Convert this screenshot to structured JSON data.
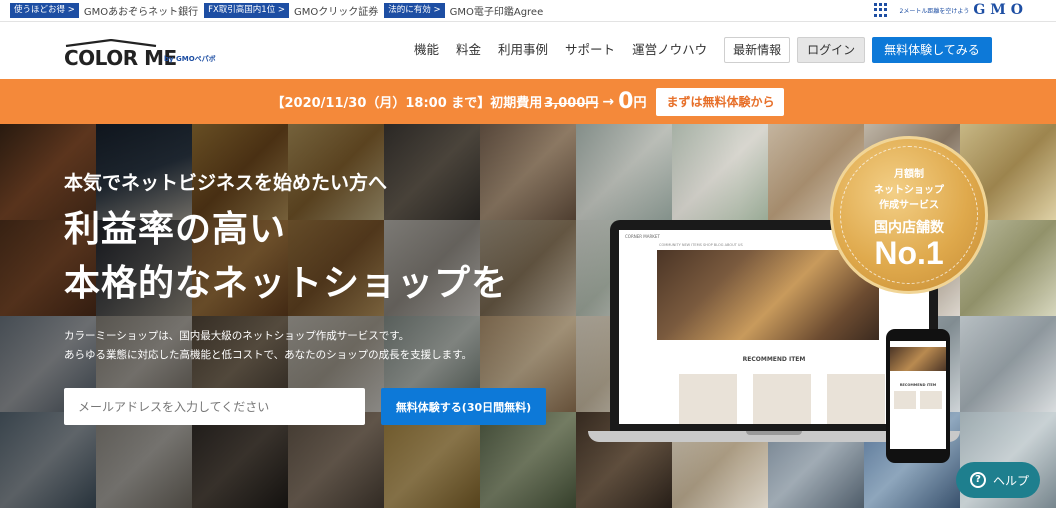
{
  "gmo_bar": {
    "links": [
      {
        "badge": "使うほどお得 >",
        "text": "GMOあおぞらネット銀行"
      },
      {
        "badge": "FX取引高国内1位 >",
        "text": "GMOクリック証券"
      },
      {
        "badge": "法的に有効 >",
        "text": "GMO電子印鑑Agree"
      }
    ],
    "tagline": "2メートル距離を空けよう",
    "logo": "GMO"
  },
  "header": {
    "logo_text": "COLOR ME",
    "logo_by": "by GMOペパボ",
    "nav": [
      "機能",
      "料金",
      "利用事例",
      "サポート",
      "運営ノウハウ"
    ],
    "news_label": "最新情報",
    "login_label": "ログイン",
    "trial_label": "無料体験してみる"
  },
  "campaign": {
    "text": "【2020/11/30（月）18:00 まで】初期費用",
    "old_price": "3,000円",
    "arrow": "→",
    "new_price": "0",
    "yen": "円",
    "button_label": "まずは無料体験から",
    "colors": {
      "background": "#f4893a"
    }
  },
  "hero": {
    "lead": "本気でネットビジネスを始めたい方へ",
    "headline1": "利益率の高い",
    "headline2": "本格的なネットショップを",
    "desc1": "カラーミーショップは、国内最大級のネットショップ作成サービスです。",
    "desc2": "あらゆる業態に対応した高機能と低コストで、あなたのショップの成長を支援します。",
    "email_placeholder": "メールアドレスを入力してください",
    "cta_label": "無料体験する(30日間無料)"
  },
  "mockup": {
    "screen_nav": "CORNER MARKET",
    "screen_menu": "COMMUNITY   NEW ITEMS   SHOP BLOG   ABOUT US",
    "recommend": "RECOMMEND ITEM",
    "phone_recommend": "RECOMMEND ITEM"
  },
  "medal": {
    "line1": "月額制",
    "line2": "ネットショップ",
    "line3": "作成サービス",
    "line4": "国内店舗数",
    "line5": "No.1"
  },
  "help": {
    "icon": "question-icon",
    "label": "ヘルプ"
  }
}
